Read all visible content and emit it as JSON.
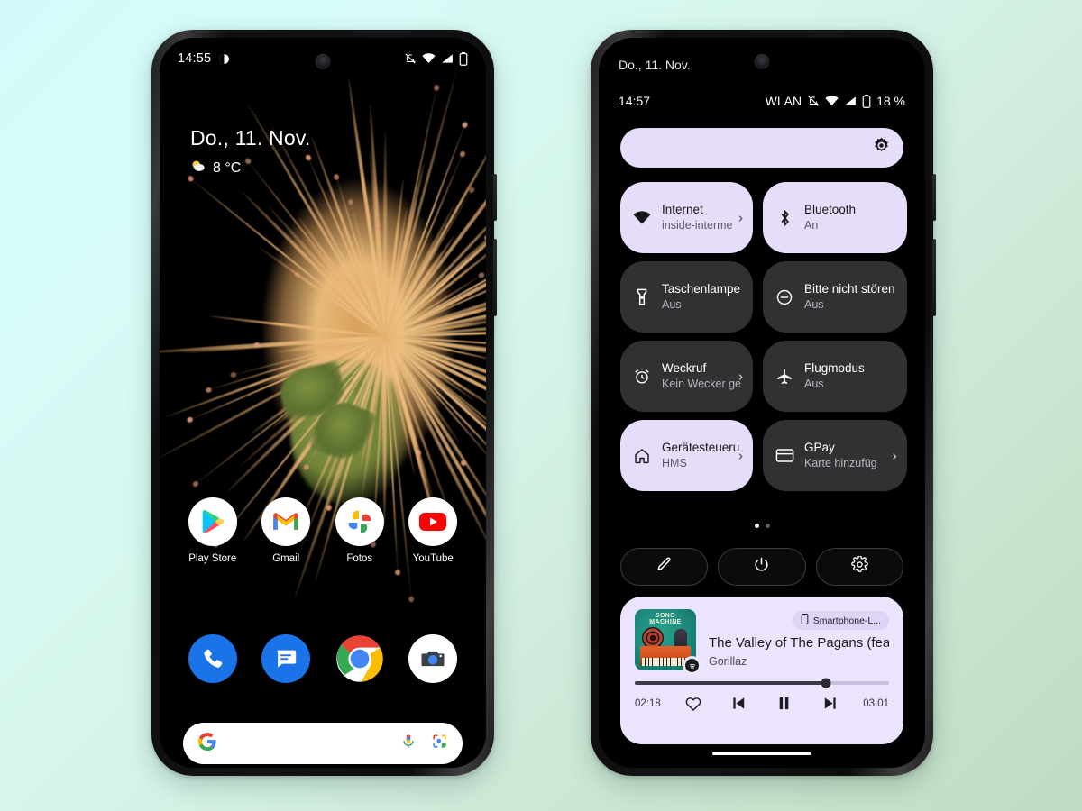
{
  "background": {
    "from": "#d4fbfa",
    "to": "#bfdcc2"
  },
  "phone_left": {
    "name": "home-screen",
    "status_bar": {
      "time": "14:55",
      "icons": [
        "notification-dot-icon",
        "ringer-off-icon",
        "wifi-icon",
        "signal-icon",
        "battery-icon"
      ]
    },
    "clock_widget": {
      "date": "Do., 11. Nov.",
      "temperature": "8 °C",
      "weather_icon": "partly-cloudy-icon"
    },
    "app_rows": [
      [
        {
          "label": "Play Store",
          "icon": "play-store-icon"
        },
        {
          "label": "Gmail",
          "icon": "gmail-icon"
        },
        {
          "label": "Fotos",
          "icon": "google-photos-icon"
        },
        {
          "label": "YouTube",
          "icon": "youtube-icon"
        }
      ],
      [
        {
          "label": "",
          "icon": "phone-icon"
        },
        {
          "label": "",
          "icon": "messages-icon"
        },
        {
          "label": "",
          "icon": "chrome-icon"
        },
        {
          "label": "",
          "icon": "camera-icon"
        }
      ]
    ],
    "search": {
      "logo": "google-g-icon",
      "mic": "microphone-icon",
      "lens": "google-lens-icon",
      "placeholder": ""
    }
  },
  "phone_right": {
    "name": "quick-settings-panel",
    "date": "Do., 11. Nov.",
    "status_bar": {
      "time": "14:57",
      "network_label": "WLAN",
      "battery_percent": "18 %",
      "icons": [
        "ringer-off-icon",
        "wifi-icon",
        "signal-icon",
        "battery-icon"
      ]
    },
    "brightness": {
      "icon": "brightness-icon",
      "level_percent": 100
    },
    "tiles": [
      {
        "title": "Internet",
        "subtitle": "inside-interme",
        "icon": "wifi-icon",
        "active": true,
        "chevron": true
      },
      {
        "title": "Bluetooth",
        "subtitle": "An",
        "icon": "bluetooth-icon",
        "active": true,
        "chevron": false
      },
      {
        "title": "Taschenlampe",
        "subtitle": "Aus",
        "icon": "flashlight-icon",
        "active": false,
        "chevron": false
      },
      {
        "title": "Bitte nicht stören",
        "subtitle": "Aus",
        "icon": "do-not-disturb-icon",
        "active": false,
        "chevron": false
      },
      {
        "title": "Weckruf",
        "subtitle": "Kein Wecker ge",
        "icon": "alarm-icon",
        "active": false,
        "chevron": true
      },
      {
        "title": "Flugmodus",
        "subtitle": "Aus",
        "icon": "airplane-icon",
        "active": false,
        "chevron": false
      },
      {
        "title": "Gerätesteueru",
        "subtitle": "HMS",
        "icon": "home-icon",
        "active": true,
        "chevron": true
      },
      {
        "title": "GPay",
        "subtitle": "Karte hinzufüg",
        "icon": "credit-card-icon",
        "active": false,
        "chevron": true
      }
    ],
    "pager": {
      "pages": 2,
      "active": 0
    },
    "controls": [
      {
        "icon": "edit-pencil-icon",
        "name": "edit-tiles-button"
      },
      {
        "icon": "power-icon",
        "name": "power-button"
      },
      {
        "icon": "gear-icon",
        "name": "settings-button"
      }
    ],
    "media": {
      "device_chip": {
        "icon": "smartphone-icon",
        "label": "Smartphone-L..."
      },
      "title": "The Valley of The Pagans (feat....",
      "artist": "Gorillaz",
      "album_art_text": "SONG MACHINE",
      "app_badge": "spotify-icon",
      "elapsed": "02:18",
      "duration": "03:01",
      "progress_percent": 75,
      "transport": [
        "favorite-heart-icon",
        "previous-track-icon",
        "pause-icon",
        "next-track-icon"
      ]
    }
  },
  "accent": {
    "tile_on_bg": "#e6ddfb",
    "tile_off_bg": "#313134",
    "media_bg": "#ece4fc"
  }
}
